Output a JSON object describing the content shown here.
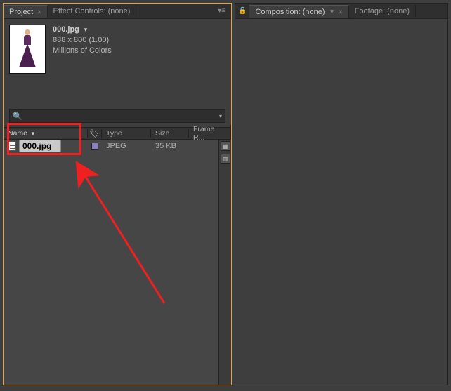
{
  "left": {
    "tabs": {
      "project": "Project",
      "effect_controls": "Effect Controls: (none)"
    },
    "info": {
      "filename": "000.jpg",
      "dimensions": "888 x 800 (1.00)",
      "colors": "Millions of Colors"
    },
    "columns": {
      "name": "Name",
      "type": "Type",
      "size": "Size",
      "framer": "Frame R..."
    },
    "rows": [
      {
        "name": "000.jpg",
        "type": "JPEG",
        "size": "35 KB"
      }
    ]
  },
  "right": {
    "tabs": {
      "composition": "Composition: (none)",
      "footage": "Footage: (none)"
    }
  }
}
